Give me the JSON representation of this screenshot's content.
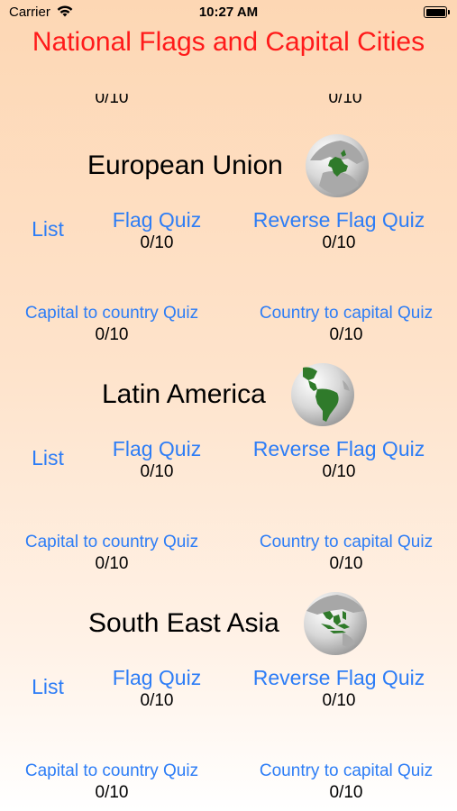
{
  "status_bar": {
    "carrier": "Carrier",
    "time": "10:27 AM"
  },
  "app_title": "National Flags and Capital Cities",
  "partial_row": {
    "left_score": "0/10",
    "right_score": "0/10"
  },
  "sections": [
    {
      "name": "European Union",
      "globe_icon": "globe-europe-icon",
      "list_label": "List",
      "flag_quiz_label": "Flag Quiz",
      "flag_quiz_score": "0/10",
      "reverse_flag_quiz_label": "Reverse Flag Quiz",
      "reverse_flag_quiz_score": "0/10",
      "capital_to_country_label": "Capital to country Quiz",
      "capital_to_country_score": "0/10",
      "country_to_capital_label": "Country to capital Quiz",
      "country_to_capital_score": "0/10"
    },
    {
      "name": "Latin America",
      "globe_icon": "globe-latin-america-icon",
      "list_label": "List",
      "flag_quiz_label": "Flag Quiz",
      "flag_quiz_score": "0/10",
      "reverse_flag_quiz_label": "Reverse Flag Quiz",
      "reverse_flag_quiz_score": "0/10",
      "capital_to_country_label": "Capital to country Quiz",
      "capital_to_country_score": "0/10",
      "country_to_capital_label": "Country to capital Quiz",
      "country_to_capital_score": "0/10"
    },
    {
      "name": "South East Asia",
      "globe_icon": "globe-south-east-asia-icon",
      "list_label": "List",
      "flag_quiz_label": "Flag Quiz",
      "flag_quiz_score": "0/10",
      "reverse_flag_quiz_label": "Reverse Flag Quiz",
      "reverse_flag_quiz_score": "0/10",
      "capital_to_country_label": "Capital to country Quiz",
      "capital_to_country_score": "0/10",
      "country_to_capital_label": "Country to capital Quiz",
      "country_to_capital_score": "0/10"
    }
  ],
  "colors": {
    "title": "#ff1a1a",
    "link": "#2d7df6",
    "land": "#2f7a2a",
    "globe_gray": "#b9b9b9"
  }
}
